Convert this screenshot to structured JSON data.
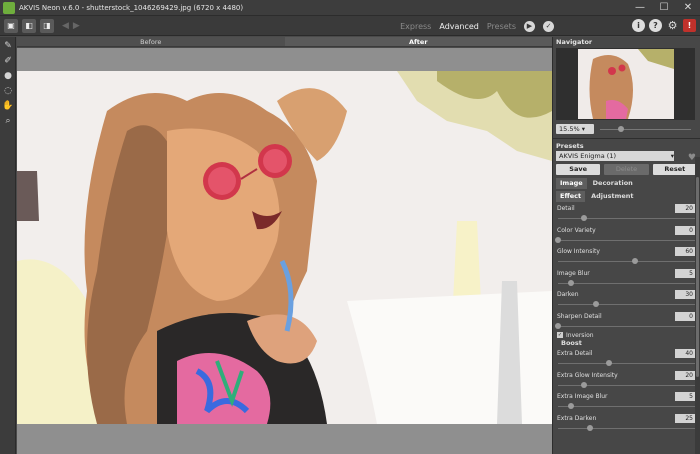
{
  "window": {
    "title": "AKVIS Neon v.6.0 - shutterstock_1046269429.jpg (6720 x 4480)",
    "minimize": "—",
    "maximize": "☐",
    "close": "✕"
  },
  "toolbar": {
    "modes": [
      "Express",
      "Advanced",
      "Presets"
    ],
    "active_mode": "Advanced",
    "icons": [
      "info-icon",
      "help-icon",
      "settings-icon",
      "tips-icon"
    ]
  },
  "preview_tabs": [
    "Before",
    "After"
  ],
  "active_preview_tab": "After",
  "navigator": {
    "title": "Navigator",
    "zoom": "15.5%",
    "zoom_fraction": 0.2
  },
  "presets": {
    "title": "Presets",
    "selected": "AKVIS Enigma (1)",
    "save": "Save",
    "delete": "Delete",
    "reset": "Reset"
  },
  "tabs": {
    "image": "Image",
    "decoration": "Decoration",
    "effect": "Effect",
    "adjustment": "Adjustment"
  },
  "params": [
    {
      "label": "Detail",
      "value": "20",
      "fraction": 0.2
    },
    {
      "label": "Color Variety",
      "value": "0",
      "fraction": 0.0
    },
    {
      "label": "Glow Intensity",
      "value": "60",
      "fraction": 0.6
    },
    {
      "label": "Image Blur",
      "value": "5",
      "fraction": 0.1
    },
    {
      "label": "Darken",
      "value": "30",
      "fraction": 0.3
    },
    {
      "label": "Sharpen Detail",
      "value": "0",
      "fraction": 0.0
    }
  ],
  "inversion": "Inversion",
  "boost": "Boost",
  "boost_params": [
    {
      "label": "Extra Detail",
      "value": "40",
      "fraction": 0.4
    },
    {
      "label": "Extra Glow Intensity",
      "value": "20",
      "fraction": 0.2
    },
    {
      "label": "Extra Image Blur",
      "value": "5",
      "fraction": 0.1
    },
    {
      "label": "Extra Darken",
      "value": "25",
      "fraction": 0.25
    }
  ]
}
